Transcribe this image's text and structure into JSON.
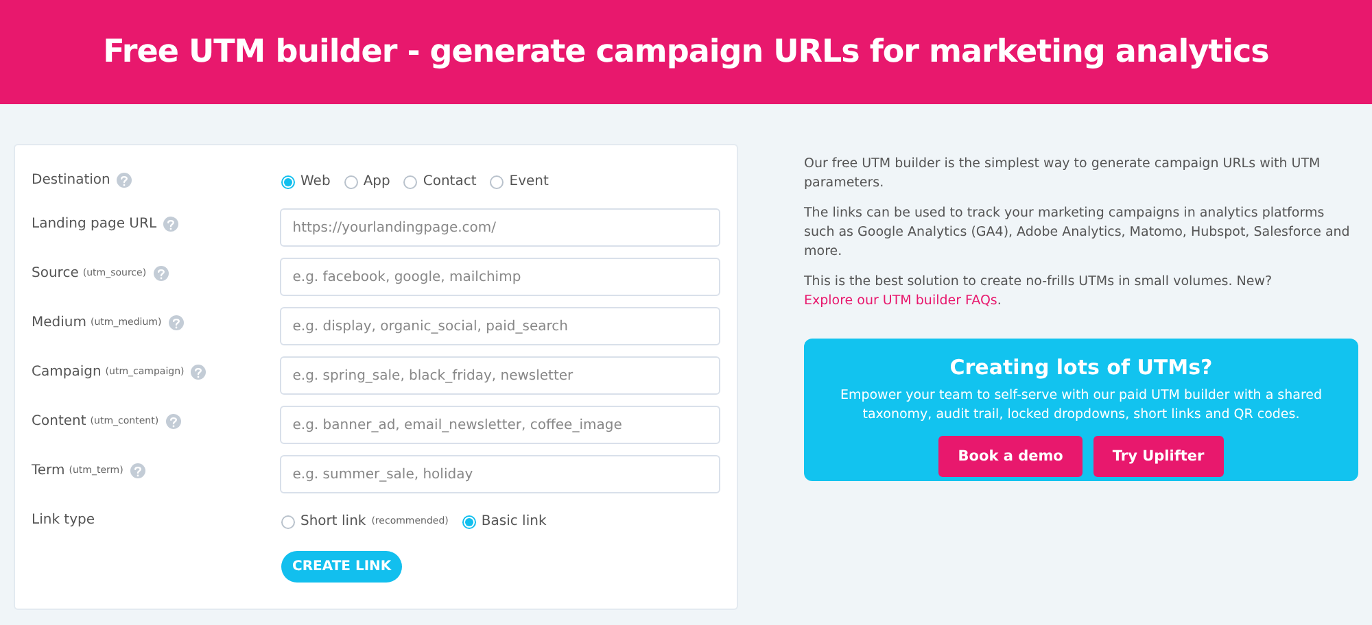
{
  "title": "Free UTM builder - generate campaign URLs for marketing analytics",
  "form": {
    "rows": [
      {
        "kind": "radio",
        "label": "Destination",
        "help": true,
        "options": [
          {
            "label": "Web",
            "selected": true
          },
          {
            "label": "App",
            "selected": false
          },
          {
            "label": "Contact",
            "selected": false
          },
          {
            "label": "Event",
            "selected": false
          }
        ]
      },
      {
        "kind": "text",
        "label": "Landing page URL",
        "help": true,
        "placeholder": "https://yourlandingpage.com/"
      },
      {
        "kind": "text",
        "label": "Source",
        "param": "(utm_source)",
        "help": true,
        "placeholder": "e.g. facebook, google, mailchimp"
      },
      {
        "kind": "text",
        "label": "Medium",
        "param": "(utm_medium)",
        "help": true,
        "placeholder": "e.g. display, organic_social, paid_search"
      },
      {
        "kind": "text",
        "label": "Campaign",
        "param": "(utm_campaign)",
        "help": true,
        "placeholder": "e.g. spring_sale, black_friday, newsletter"
      },
      {
        "kind": "text",
        "label": "Content",
        "param": "(utm_content)",
        "help": true,
        "placeholder": "e.g. banner_ad, email_newsletter, coffee_image"
      },
      {
        "kind": "text",
        "label": "Term",
        "param": "(utm_term)",
        "help": true,
        "placeholder": "e.g. summer_sale, holiday"
      },
      {
        "kind": "radio",
        "label": "Link type",
        "help": false,
        "options": [
          {
            "label": "Short link",
            "note": "(recommended)",
            "selected": false
          },
          {
            "label": "Basic link",
            "selected": true
          }
        ]
      }
    ],
    "submit": "CREATE LINK"
  },
  "intro": [
    {
      "text": "Our free UTM builder is the simplest way to generate campaign URLs with UTM parameters."
    },
    {
      "text": "The links can be used to track your marketing campaigns in analytics platforms such as Google Analytics (GA4), Adobe Analytics, Matomo, Hubspot, Salesforce and more."
    },
    {
      "text": "This is the best solution to create no-frills UTMs in small volumes. New?",
      "link": "Explore our UTM builder FAQs",
      "after": "."
    }
  ],
  "promo": {
    "title": "Creating lots of UTMs?",
    "text": "Empower your team to self-serve with our paid UTM builder with a shared taxonomy, audit trail, locked dropdowns, short links and QR codes.",
    "buttons": [
      "Book a demo",
      "Try Uplifter"
    ]
  }
}
